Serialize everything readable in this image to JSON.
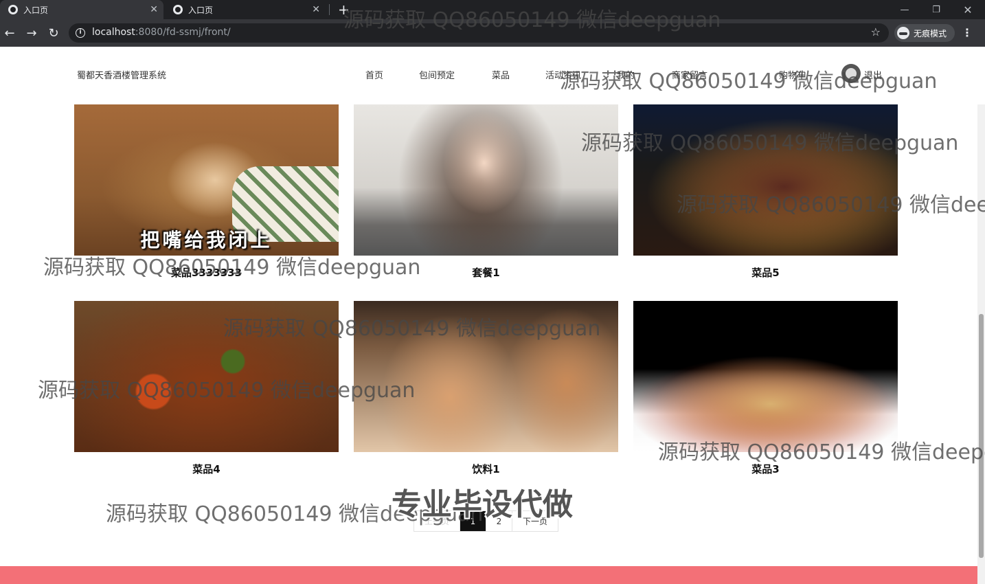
{
  "browser": {
    "tabs": [
      {
        "title": "入口页",
        "active": true
      },
      {
        "title": "入口页",
        "active": false
      }
    ],
    "new_tab": "+",
    "url_host": "localhost",
    "url_rest": ":8080/fd-ssmj/front/",
    "incognito_label": "无痕模式"
  },
  "site": {
    "brand": "蜀都天香酒楼管理系统",
    "nav": [
      "首页",
      "包间预定",
      "菜品",
      "活动资讯",
      "我的",
      "商家留言",
      "购物车",
      "退出"
    ]
  },
  "products": [
    {
      "name": "菜品3333333",
      "image_caption": "把嘴给我闭上"
    },
    {
      "name": "套餐1"
    },
    {
      "name": "菜品5"
    },
    {
      "name": "菜品4"
    },
    {
      "name": "饮料1"
    },
    {
      "name": "菜品3"
    }
  ],
  "pagination": {
    "prev": "上一页",
    "pages": [
      "1",
      "2"
    ],
    "current": "1",
    "next": "下一页"
  },
  "watermark": "源码获取 QQ86050149 微信deepguan",
  "promo": "专业毕设代做",
  "colors": {
    "footer": "#f37077",
    "chrome_dark": "#202124",
    "active_page": "#111111"
  }
}
